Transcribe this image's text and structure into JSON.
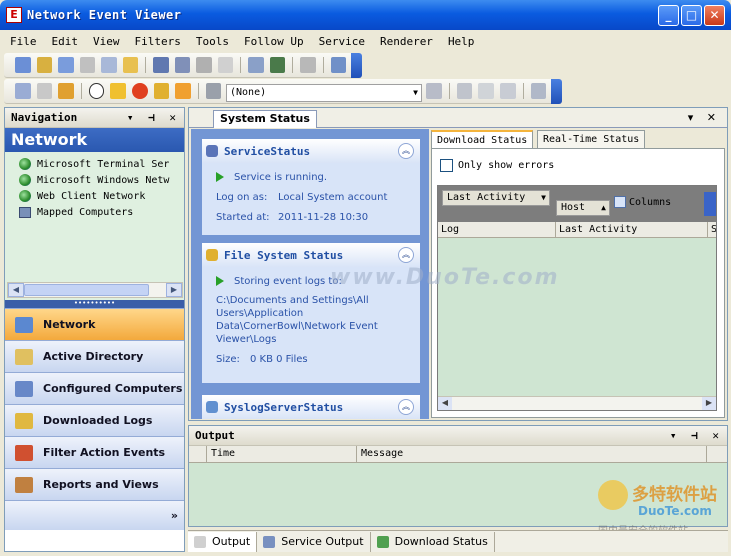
{
  "window": {
    "title": "Network Event Viewer"
  },
  "menu": [
    "File",
    "Edit",
    "View",
    "Filters",
    "Tools",
    "Follow Up",
    "Service",
    "Renderer",
    "Help"
  ],
  "toolbar": {
    "filter_value": "(None)"
  },
  "nav": {
    "header": "Navigation",
    "section_title": "Network",
    "tree": [
      "Microsoft Terminal Ser",
      "Microsoft Windows Netw",
      "Web Client Network",
      "Mapped Computers"
    ],
    "buttons": [
      "Network",
      "Active Directory",
      "Configured Computers",
      "Downloaded Logs",
      "Filter Action Events",
      "Reports and Views"
    ]
  },
  "doc": {
    "tab": "System Status",
    "service_card": {
      "title": "ServiceStatus",
      "status": "Service is running.",
      "logon_label": "Log on as:",
      "logon_value": "Local System account",
      "started_label": "Started at:",
      "started_value": "2011-11-28 10:30"
    },
    "fs_card": {
      "title": "File System Status",
      "status": "Storing event logs to:",
      "path": "C:\\Documents and Settings\\All Users\\Application Data\\CornerBowl\\Network Event Viewer\\Logs",
      "size_label": "Size:",
      "size_value": "0 KB 0 Files"
    },
    "syslog_card": {
      "title": "SyslogServerStatus"
    },
    "right_tabs": [
      "Download Status",
      "Real-Time Status"
    ],
    "only_errors": "Only show errors",
    "group_chip1": "Last Activity",
    "group_chip2": "Host",
    "columns_btn": "Columns",
    "grid_cols": [
      "Log",
      "Last Activity",
      "S"
    ]
  },
  "output": {
    "header": "Output",
    "cols": [
      "Time",
      "Message"
    ]
  },
  "bottom_tabs": [
    "Output",
    "Service Output",
    "Download Status"
  ],
  "watermark": "www.DuoTe.com",
  "watermark2": {
    "brand": "多特软件站",
    "url": "DuoTe.com",
    "slogan": "国内最安全的软件站"
  }
}
